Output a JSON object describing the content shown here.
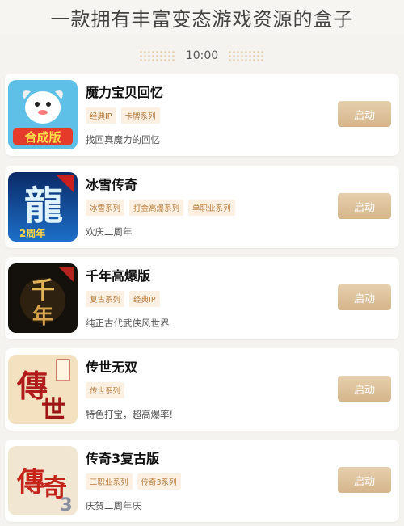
{
  "header": {
    "title": "一款拥有丰富变态游戏资源的盒子"
  },
  "timebar": {
    "time": "10:00"
  },
  "games": [
    {
      "title": "魔力宝贝回忆",
      "tags": [
        "经典IP",
        "卡牌系列"
      ],
      "desc": "找回真魔力的回忆",
      "button": "启动",
      "icon": "magic-baby-logo"
    },
    {
      "title": "冰雪传奇",
      "tags": [
        "冰雪系列",
        "打金高爆系列",
        "单职业系列"
      ],
      "desc": "欢庆二周年",
      "button": "启动",
      "icon": "ice-dragon-logo"
    },
    {
      "title": "千年高爆版",
      "tags": [
        "复古系列",
        "经典IP"
      ],
      "desc": "纯正古代武侠风世界",
      "button": "启动",
      "icon": "millennium-logo"
    },
    {
      "title": "传世无双",
      "tags": [
        "传世系列"
      ],
      "desc": "特色打宝，超高爆率!",
      "button": "启动",
      "icon": "chuanshi-logo"
    },
    {
      "title": "传奇3复古版",
      "tags": [
        "三职业系列",
        "传奇3系列"
      ],
      "desc": "庆贺二周年庆",
      "button": "启动",
      "icon": "legend3-logo"
    }
  ],
  "colors": {
    "accent": "#d5b58b",
    "tag_text": "#b67b3a",
    "tag_bg": "#fbf0e2"
  }
}
